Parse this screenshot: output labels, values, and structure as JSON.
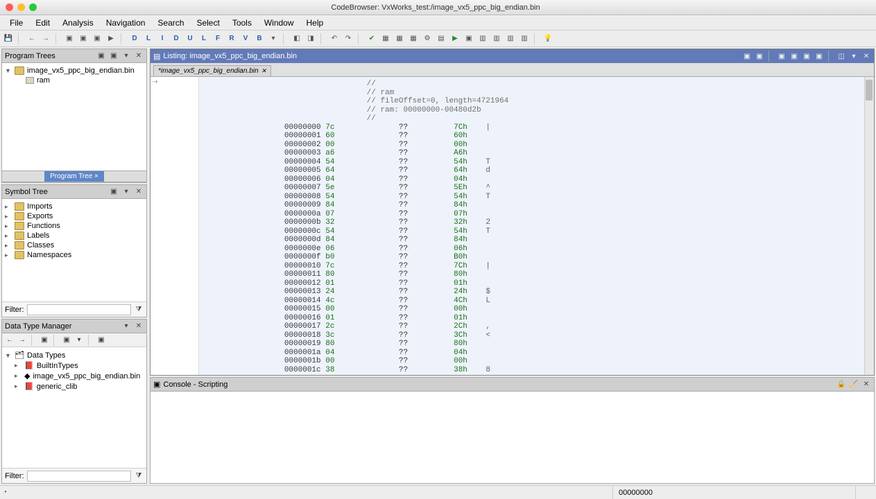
{
  "window": {
    "title": "CodeBrowser: VxWorks_test:/image_vx5_ppc_big_endian.bin"
  },
  "menubar": [
    "File",
    "Edit",
    "Analysis",
    "Navigation",
    "Search",
    "Select",
    "Tools",
    "Window",
    "Help"
  ],
  "program_tree": {
    "title": "Program Trees",
    "root": "image_vx5_ppc_big_endian.bin",
    "child": "ram",
    "tab": "Program Tree  ×"
  },
  "symbol_tree": {
    "title": "Symbol Tree",
    "items": [
      "Imports",
      "Exports",
      "Functions",
      "Labels",
      "Classes",
      "Namespaces"
    ],
    "filter_label": "Filter:"
  },
  "dtm": {
    "title": "Data Type Manager",
    "root": "Data Types",
    "items": [
      "BuiltInTypes",
      "image_vx5_ppc_big_endian.bin",
      "generic_clib"
    ],
    "filter_label": "Filter:"
  },
  "listing": {
    "title": "Listing: image_vx5_ppc_big_endian.bin",
    "tab": "*image_vx5_ppc_big_endian.bin",
    "comments": [
      "//",
      "// ram",
      "// fileOffset=0, length=4721964",
      "// ram: 00000000-00480d2b",
      "//"
    ],
    "rows": [
      {
        "addr": "00000000",
        "b": "7c",
        "h": "7Ch",
        "a": "|"
      },
      {
        "addr": "00000001",
        "b": "60",
        "h": "60h",
        "a": ""
      },
      {
        "addr": "00000002",
        "b": "00",
        "h": "00h",
        "a": ""
      },
      {
        "addr": "00000003",
        "b": "a6",
        "h": "A6h",
        "a": ""
      },
      {
        "addr": "00000004",
        "b": "54",
        "h": "54h",
        "a": "T"
      },
      {
        "addr": "00000005",
        "b": "64",
        "h": "64h",
        "a": "d"
      },
      {
        "addr": "00000006",
        "b": "04",
        "h": "04h",
        "a": ""
      },
      {
        "addr": "00000007",
        "b": "5e",
        "h": "5Eh",
        "a": "^"
      },
      {
        "addr": "00000008",
        "b": "54",
        "h": "54h",
        "a": "T"
      },
      {
        "addr": "00000009",
        "b": "84",
        "h": "84h",
        "a": ""
      },
      {
        "addr": "0000000a",
        "b": "07",
        "h": "07h",
        "a": ""
      },
      {
        "addr": "0000000b",
        "b": "32",
        "h": "32h",
        "a": "2"
      },
      {
        "addr": "0000000c",
        "b": "54",
        "h": "54h",
        "a": "T"
      },
      {
        "addr": "0000000d",
        "b": "84",
        "h": "84h",
        "a": ""
      },
      {
        "addr": "0000000e",
        "b": "06",
        "h": "06h",
        "a": ""
      },
      {
        "addr": "0000000f",
        "b": "b0",
        "h": "B0h",
        "a": ""
      },
      {
        "addr": "00000010",
        "b": "7c",
        "h": "7Ch",
        "a": "|"
      },
      {
        "addr": "00000011",
        "b": "80",
        "h": "80h",
        "a": ""
      },
      {
        "addr": "00000012",
        "b": "01",
        "h": "01h",
        "a": ""
      },
      {
        "addr": "00000013",
        "b": "24",
        "h": "24h",
        "a": "$"
      },
      {
        "addr": "00000014",
        "b": "4c",
        "h": "4Ch",
        "a": "L"
      },
      {
        "addr": "00000015",
        "b": "00",
        "h": "00h",
        "a": ""
      },
      {
        "addr": "00000016",
        "b": "01",
        "h": "01h",
        "a": ""
      },
      {
        "addr": "00000017",
        "b": "2c",
        "h": "2Ch",
        "a": ","
      },
      {
        "addr": "00000018",
        "b": "3c",
        "h": "3Ch",
        "a": "<"
      },
      {
        "addr": "00000019",
        "b": "80",
        "h": "80h",
        "a": ""
      },
      {
        "addr": "0000001a",
        "b": "04",
        "h": "04h",
        "a": ""
      },
      {
        "addr": "0000001b",
        "b": "00",
        "h": "00h",
        "a": ""
      },
      {
        "addr": "0000001c",
        "b": "38",
        "h": "38h",
        "a": "8"
      }
    ]
  },
  "console": {
    "title": "Console - Scripting"
  },
  "status": {
    "addr": "00000000"
  }
}
